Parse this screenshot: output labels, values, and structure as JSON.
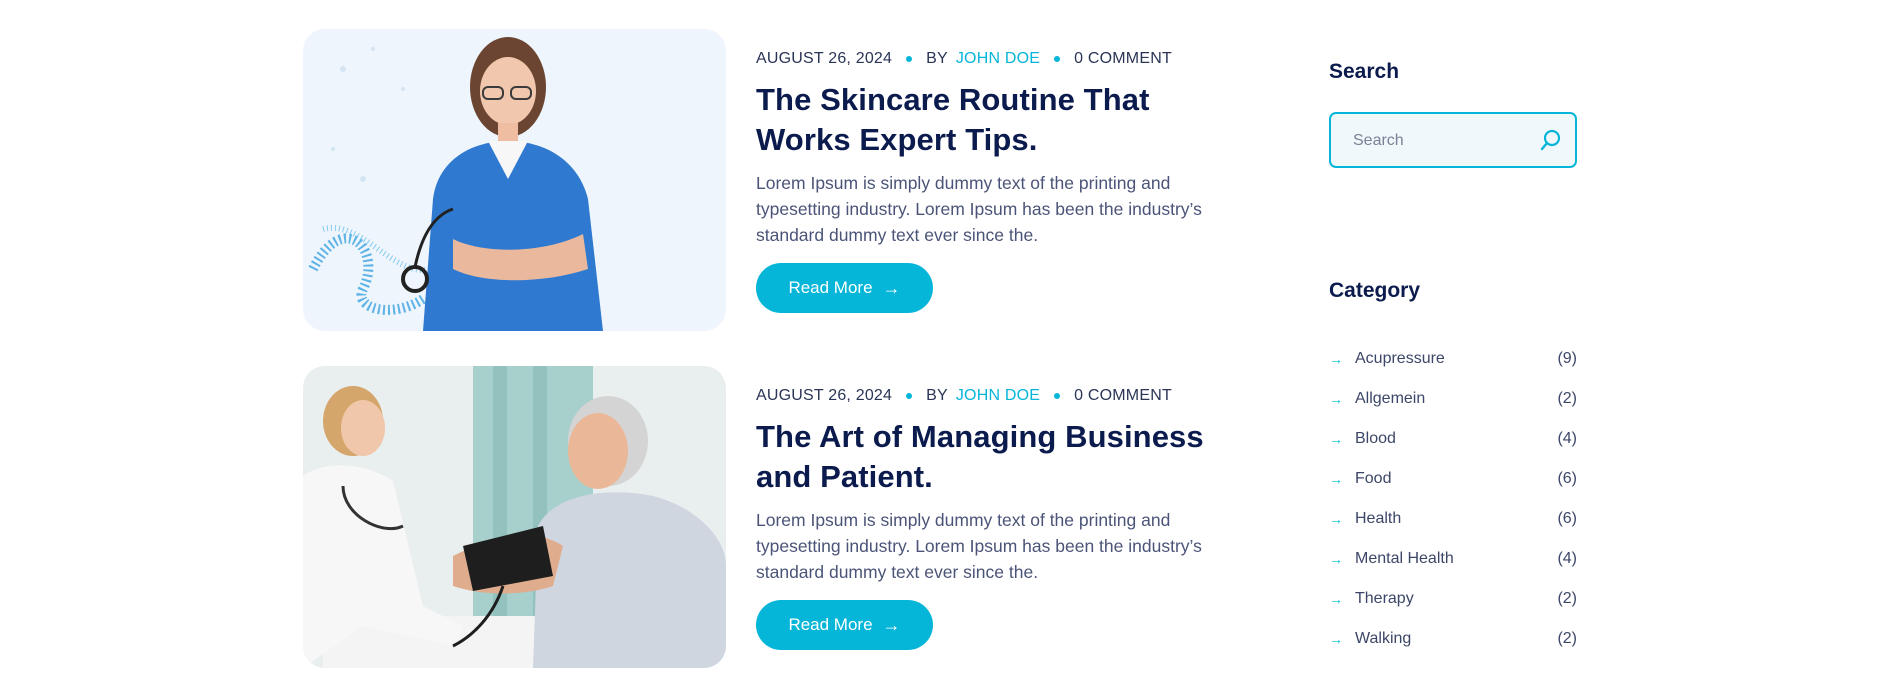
{
  "posts": [
    {
      "date": "AUGUST 26, 2024",
      "by": "BY",
      "author": "JOHN DOE",
      "comments": "0 COMMENT",
      "title": "The Skincare Routine That Works Expert Tips.",
      "excerpt": "Lorem Ipsum is simply dummy text of the printing and typesetting industry. Lorem Ipsum has been the industry’s standard dummy text ever since the.",
      "read_more": "Read More"
    },
    {
      "date": "AUGUST 26, 2024",
      "by": "BY",
      "author": "JOHN DOE",
      "comments": "0 COMMENT",
      "title": "The Art of Managing Business and Patient.",
      "excerpt": "Lorem Ipsum is simply dummy text of the printing and typesetting industry. Lorem Ipsum has been the industry’s standard dummy text ever since the.",
      "read_more": "Read More"
    }
  ],
  "sidebar": {
    "search_title": "Search",
    "search_placeholder": "Search",
    "category_title": "Category",
    "categories": [
      {
        "name": "Acupressure",
        "count": "(9)"
      },
      {
        "name": "Allgemein",
        "count": "(2)"
      },
      {
        "name": "Blood",
        "count": "(4)"
      },
      {
        "name": "Food",
        "count": "(6)"
      },
      {
        "name": "Health",
        "count": "(6)"
      },
      {
        "name": "Mental Health",
        "count": "(4)"
      },
      {
        "name": "Therapy",
        "count": "(2)"
      },
      {
        "name": "Walking",
        "count": "(2)"
      }
    ]
  },
  "icons": {
    "readmore": "arrow-right-icon",
    "search": "search-icon",
    "category": "arrow-right-icon"
  },
  "colors": {
    "accent": "#06b6d9",
    "heading": "#0b1b4d",
    "body_text": "#4b5478"
  }
}
